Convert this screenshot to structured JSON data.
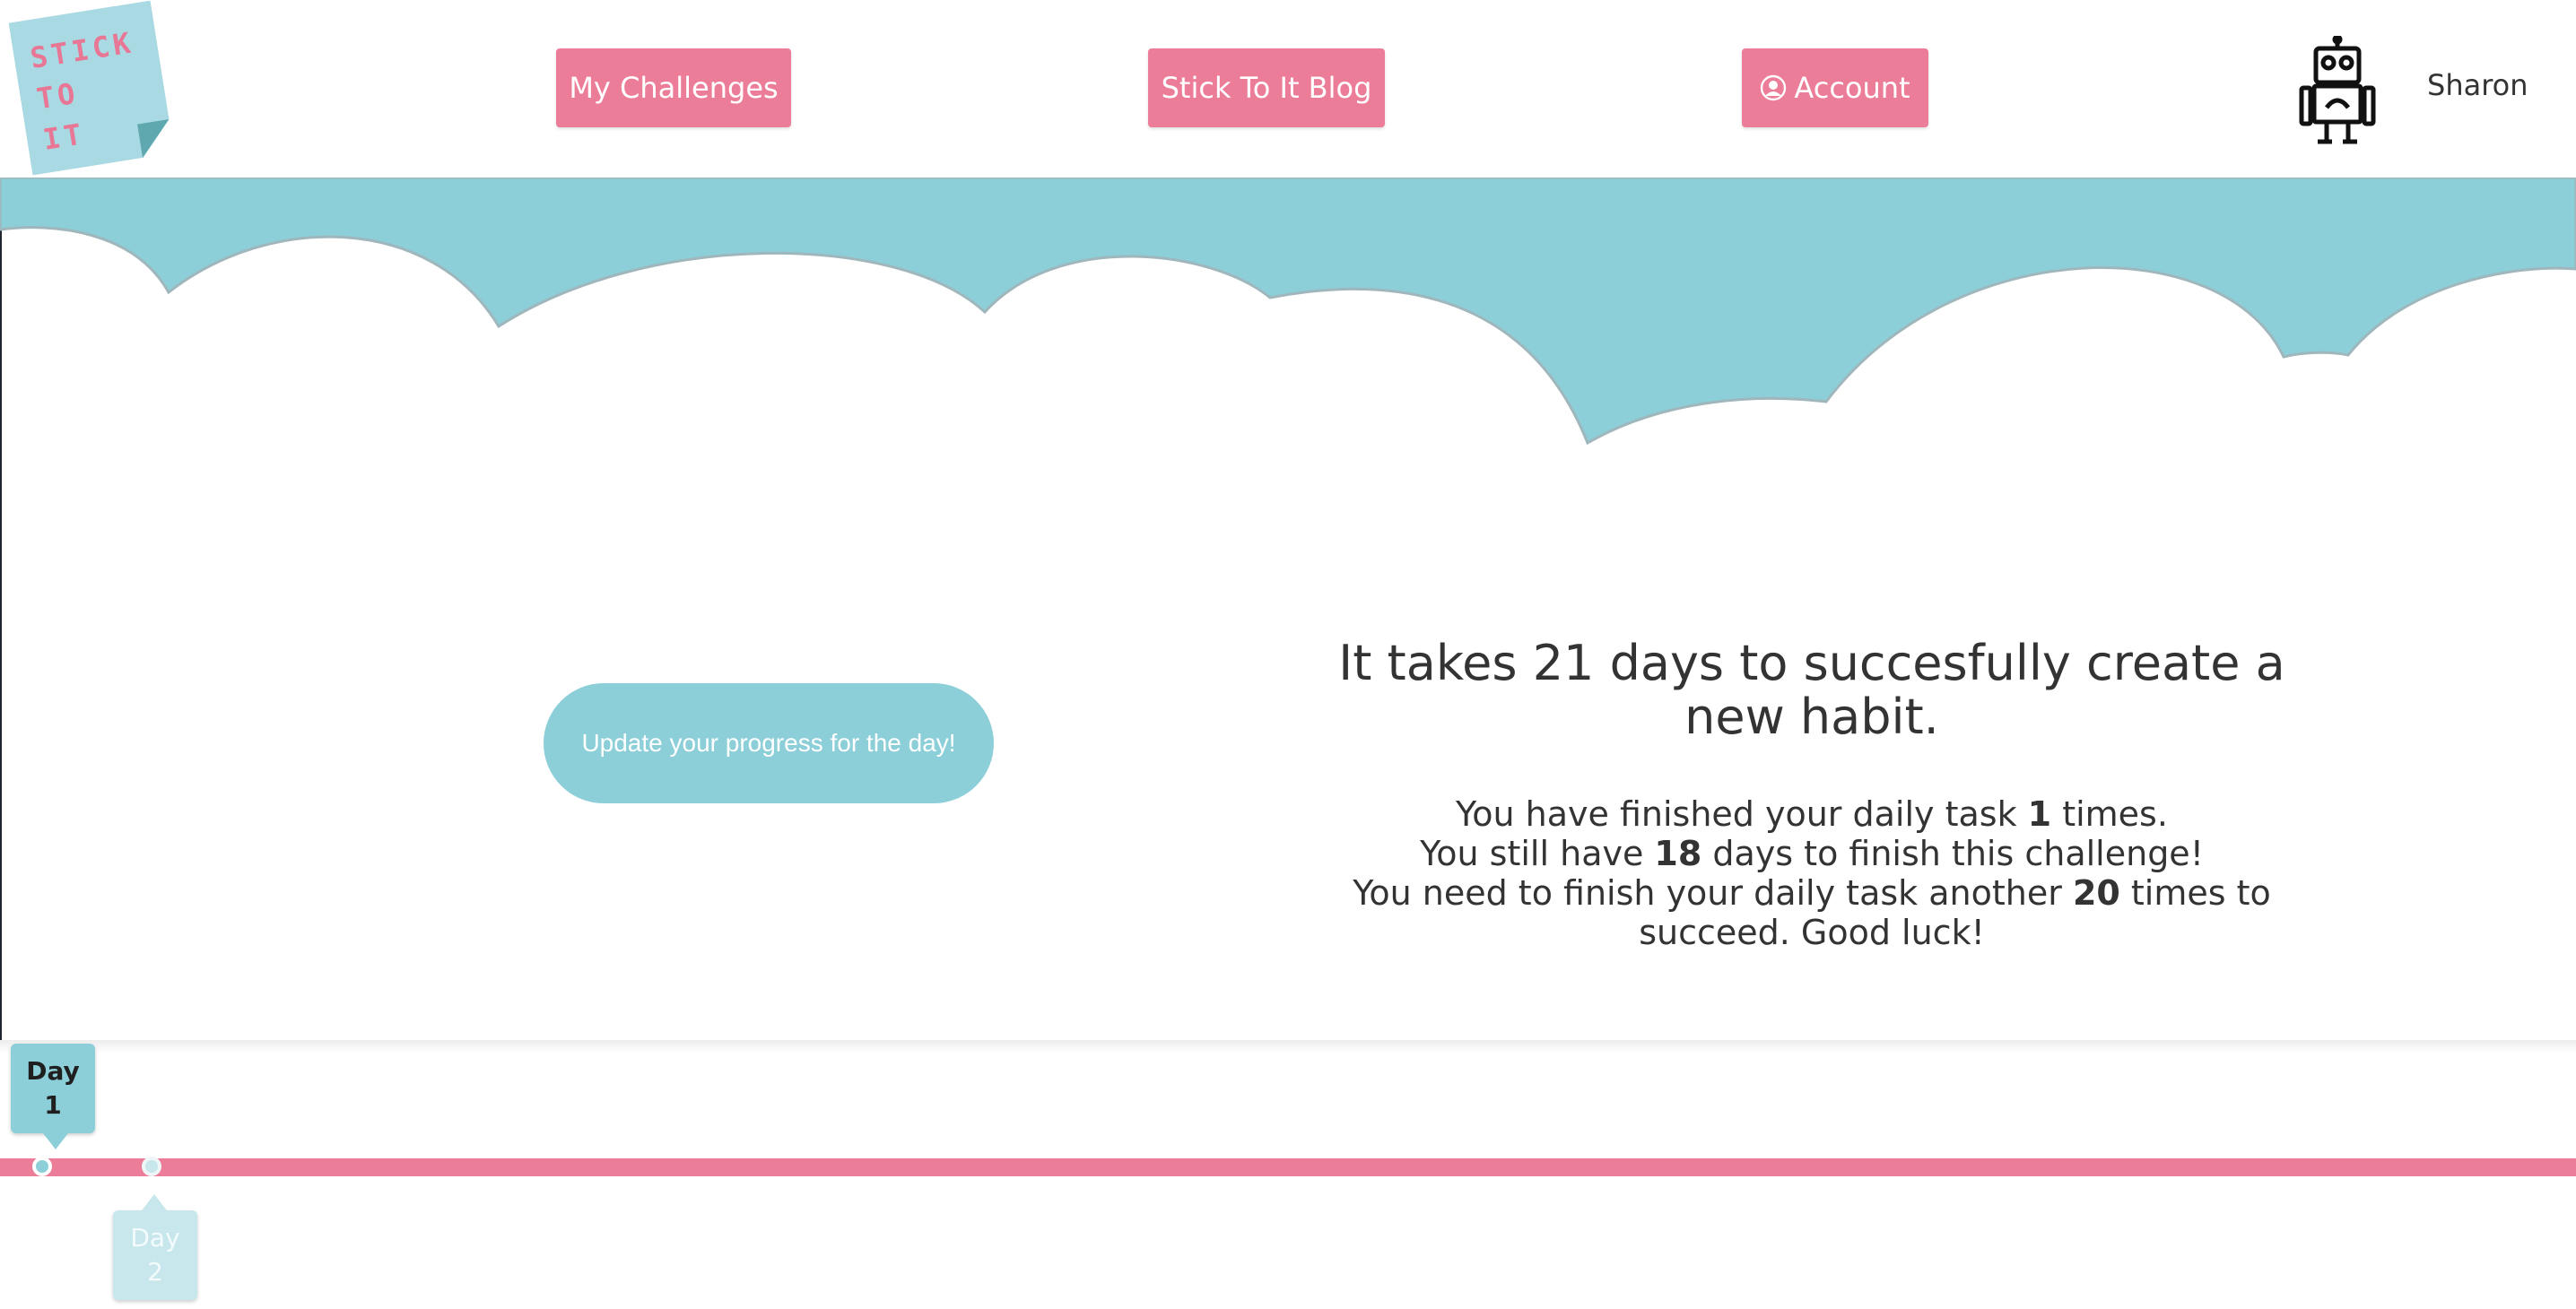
{
  "logo": {
    "lines": [
      "STICK",
      "TO",
      "IT"
    ]
  },
  "nav": {
    "my_challenges": "My Challenges",
    "blog": "Stick To It Blog",
    "account": "Account"
  },
  "user": {
    "name": "Sharon",
    "avatar_icon": "robot-icon"
  },
  "main": {
    "update_button": "Update your progress for the day!",
    "headline": "It takes 21 days to succesfully create a new habit.",
    "finished_prefix": "You have finished your daily task ",
    "finished_count": "1",
    "finished_suffix": " times.",
    "remaining_prefix": "You still have ",
    "remaining_days": "18",
    "remaining_suffix": " days to finish this challenge!",
    "needed_prefix": "You need to finish your daily task another ",
    "needed_count": "20",
    "needed_suffix": " times to succeed. Good luck!"
  },
  "timeline": {
    "days": [
      {
        "label": "Day",
        "number": "1",
        "state": "current"
      },
      {
        "label": "Day",
        "number": "2",
        "state": "upcoming"
      }
    ]
  },
  "colors": {
    "pink": "#ec7d98",
    "teal": "#8ccfd8",
    "text": "#333333"
  }
}
